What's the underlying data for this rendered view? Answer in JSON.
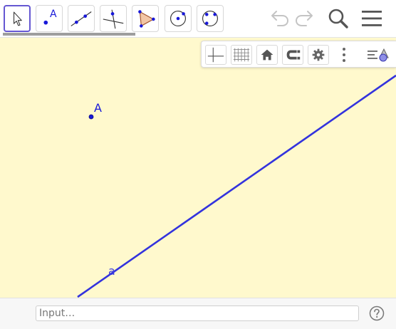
{
  "toolbar": {
    "tools": [
      {
        "name": "move-tool",
        "icon": "arrow-pointer-icon",
        "selected": true
      },
      {
        "name": "point-tool",
        "icon": "point-icon"
      },
      {
        "name": "line-tool",
        "icon": "line-through-points-icon"
      },
      {
        "name": "perpendicular-line-tool",
        "icon": "perpendicular-line-icon"
      },
      {
        "name": "polygon-tool",
        "icon": "polygon-icon"
      },
      {
        "name": "circle-center-point-tool",
        "icon": "circle-center-point-icon"
      },
      {
        "name": "circle-three-points-tool",
        "icon": "circle-three-points-icon"
      }
    ],
    "point_tool_letter": "A",
    "actions": [
      "undo-icon",
      "redo-icon",
      "search-icon",
      "menu-icon"
    ]
  },
  "style_bar": {
    "buttons": [
      "axes-icon",
      "grid-icon",
      "home-icon",
      "magnet-snap-icon",
      "gear-icon",
      "more-vertical-icon",
      "algebra-view-toggle-icon"
    ]
  },
  "graphics": {
    "point_label": "A",
    "line_label": "a",
    "colors": {
      "background": "#fff9cd",
      "object": "#1818d8",
      "line": "#3333dd",
      "accent": "#6557d2"
    }
  },
  "input_bar": {
    "placeholder": "Input…"
  }
}
